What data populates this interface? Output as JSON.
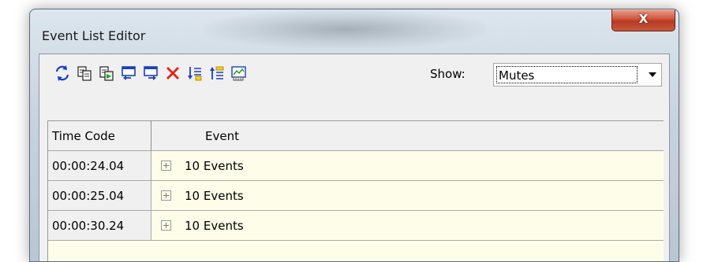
{
  "window": {
    "title": "Event List Editor",
    "close_glyph": "X"
  },
  "toolbar": {
    "buttons": [
      {
        "name": "refresh-icon"
      },
      {
        "name": "copy-icon"
      },
      {
        "name": "paste-icon"
      },
      {
        "name": "insert-before-icon"
      },
      {
        "name": "insert-after-icon"
      },
      {
        "name": "delete-icon"
      },
      {
        "name": "sort-descending-icon"
      },
      {
        "name": "sort-ascending-icon"
      },
      {
        "name": "preview-icon"
      }
    ],
    "show_label": "Show:",
    "show_value": "Mutes"
  },
  "table": {
    "columns": [
      "Time Code",
      "Event"
    ],
    "rows": [
      {
        "time_code": "00:00:24.04",
        "event": "10 Events"
      },
      {
        "time_code": "00:00:25.04",
        "event": "10 Events"
      },
      {
        "time_code": "00:00:30.24",
        "event": "10 Events"
      }
    ]
  },
  "colors": {
    "grid_background": "#fdfde9",
    "close_button": "#c94a30"
  }
}
